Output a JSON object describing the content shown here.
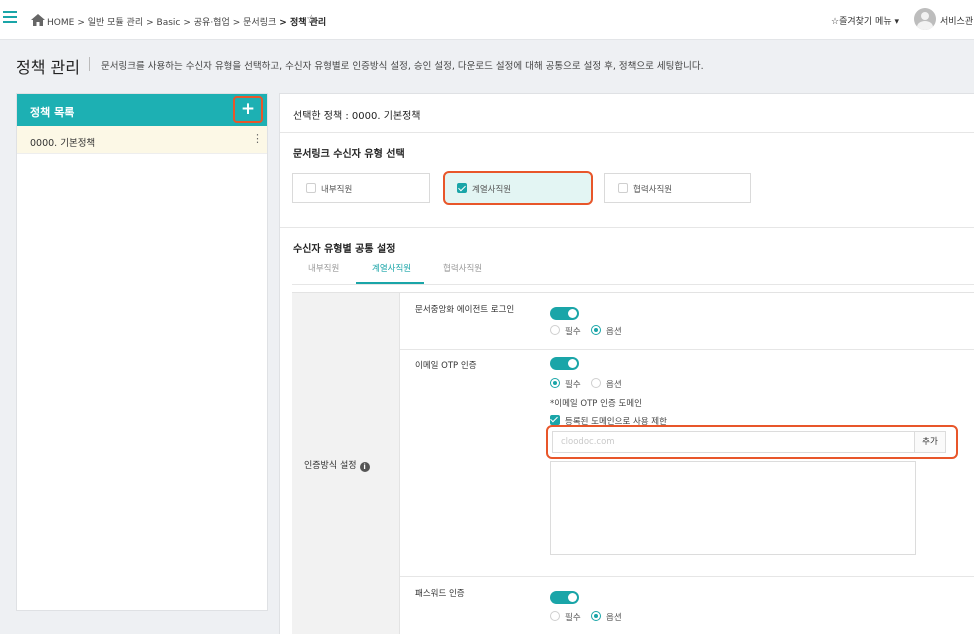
{
  "topbar": {
    "breadcrumb": [
      "HOME",
      "> 일반 모듈 관리",
      "> Basic",
      "> 공유·협업",
      "> 문서링크",
      "> 정책 관리"
    ],
    "fav_menu": "즐겨찾기 메뉴 ▾",
    "user_name": "서비스관리"
  },
  "header": {
    "title": "정책 관리",
    "description": "문서링크를 사용하는 수신자 유형을 선택하고, 수신자 유형별로 인증방식 설정, 승인 설정, 다운로드 설정에 대해 공통으로 설정 후, 정책으로 세팅합니다."
  },
  "policy_list": {
    "title": "정책 목록",
    "add_label": "+",
    "items": [
      {
        "label": "0000. 기본정책"
      }
    ]
  },
  "detail": {
    "selected_label": "선택한 정책 : 0000. 기본정책",
    "recipient_section": "문서링크 수신자 유형 선택",
    "recipient_types": [
      {
        "label": "내부직원",
        "checked": false
      },
      {
        "label": "계열사직원",
        "checked": true
      },
      {
        "label": "협력사직원",
        "checked": false
      }
    ],
    "common_section": "수신자 유형별 공통 설정",
    "tabs": [
      "내부직원",
      "계열사직원",
      "협력사직원"
    ],
    "active_tab": "계열사직원",
    "auth_label": "인증방식 설정",
    "options": [
      {
        "label": "문서중앙화 에이전트 로그인",
        "enabled": true,
        "required": "필수",
        "optional": "옵션",
        "selected": "옵션"
      },
      {
        "label": "이메일 OTP 인증",
        "enabled": true,
        "required": "필수",
        "optional": "옵션",
        "selected": "필수"
      },
      {
        "label": "패스워드 인증",
        "enabled": true,
        "required": "필수",
        "optional": "옵션",
        "selected": "옵션"
      }
    ],
    "otp_domain_note": "*이메일 OTP 인증 도메인",
    "otp_restrict_label": "등록된 도메인으로 사용 제한",
    "domain_placeholder": "cloodoc.com",
    "domain_add_label": "추가"
  },
  "colors": {
    "accent": "#1db0b3",
    "highlight": "#e8562a"
  }
}
